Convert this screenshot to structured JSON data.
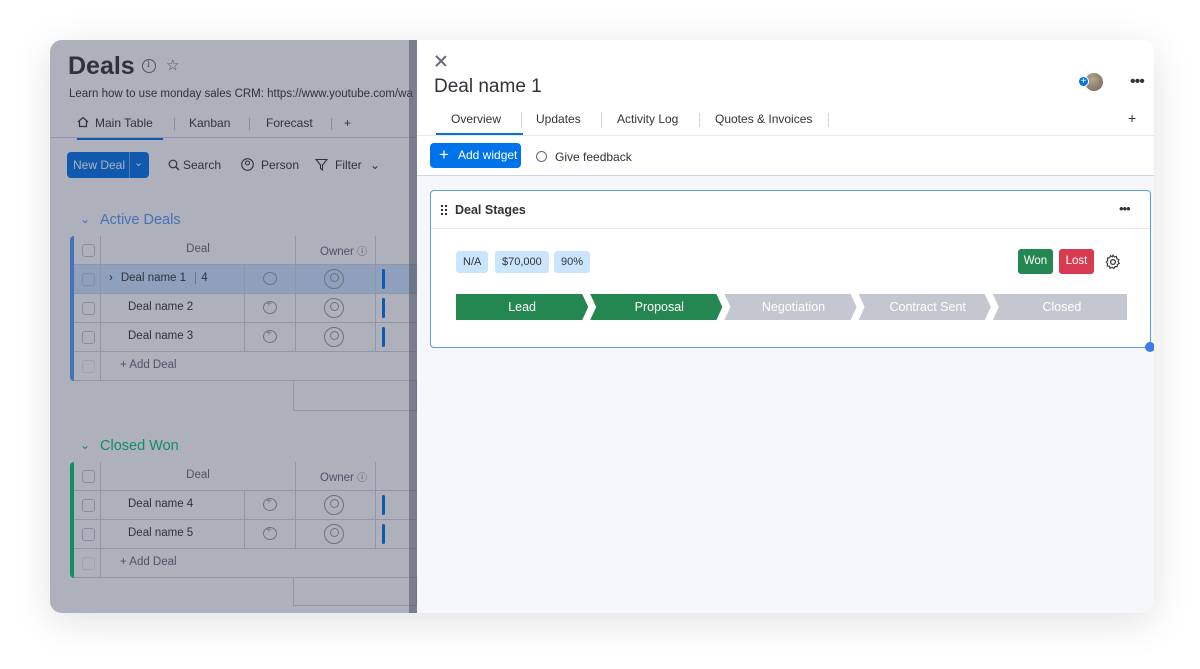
{
  "board": {
    "title": "Deals",
    "description": "Learn how to use monday sales CRM: https://www.youtube.com/wa",
    "tabs": [
      "Main Table",
      "Kanban",
      "Forecast",
      "+"
    ],
    "toolbar": {
      "new_deal": "New Deal",
      "search": "Search",
      "person": "Person",
      "filter": "Filter"
    },
    "groups": [
      {
        "title": "Active Deals",
        "color": "#579bfc",
        "columns": {
          "deal": "Deal",
          "owner": "Owner"
        },
        "rows": [
          {
            "name": "Deal name 1",
            "count": "4"
          },
          {
            "name": "Deal name 2"
          },
          {
            "name": "Deal name 3"
          }
        ],
        "add_label": "+ Add Deal"
      },
      {
        "title": "Closed Won",
        "color": "#00c875",
        "columns": {
          "deal": "Deal",
          "owner": "Owner"
        },
        "rows": [
          {
            "name": "Deal name 4"
          },
          {
            "name": "Deal name 5"
          }
        ],
        "add_label": "+ Add Deal"
      }
    ]
  },
  "panel": {
    "title": "Deal name 1",
    "tabs": [
      "Overview",
      "Updates",
      "Activity Log",
      "Quotes & Invoices"
    ],
    "tab_add": "+",
    "add_widget": "Add widget",
    "feedback": "Give feedback",
    "widget": {
      "title": "Deal Stages",
      "chips": [
        "N/A",
        "$70,000",
        "90%"
      ],
      "won": "Won",
      "lost": "Lost",
      "stages": [
        {
          "label": "Lead",
          "state": "done",
          "color": "#258750"
        },
        {
          "label": "Proposal",
          "state": "done",
          "color": "#258750"
        },
        {
          "label": "Negotiation",
          "state": "pending",
          "color": "#c5c7d0"
        },
        {
          "label": "Contract Sent",
          "state": "pending",
          "color": "#c5c7d0"
        },
        {
          "label": "Closed",
          "state": "pending",
          "color": "#c5c7d0"
        }
      ]
    }
  }
}
